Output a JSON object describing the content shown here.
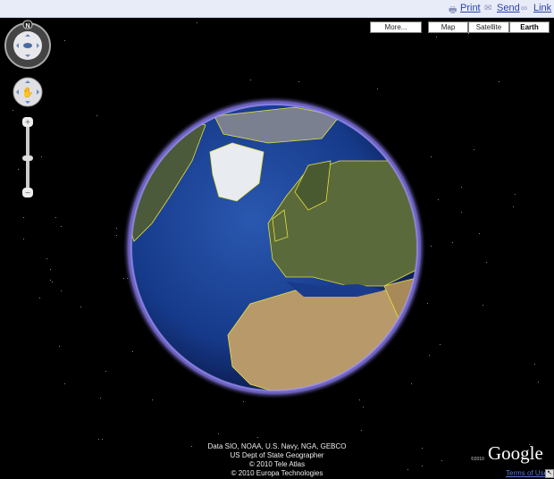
{
  "toolbar": {
    "print": "Print",
    "send": "Send",
    "link": "Link"
  },
  "map_types": {
    "more": "More...",
    "map": "Map",
    "satellite": "Satellite",
    "earth": "Earth",
    "selected": "Earth"
  },
  "nav": {
    "north": "N"
  },
  "attribution": [
    "Data SIO, NOAA, U.S. Navy, NGA, GEBCO",
    "US Dept of State Geographer",
    "© 2010 Tele Atlas",
    "© 2010 Europa Technologies"
  ],
  "logo": {
    "text": "Google",
    "copyright": "©2010"
  },
  "terms": "Terms of Use",
  "colors": {
    "ocean": "#1a3a8c",
    "atmosphere": "#8a7cf0",
    "borders": "#e8e040",
    "link": "#2a3fb0"
  }
}
